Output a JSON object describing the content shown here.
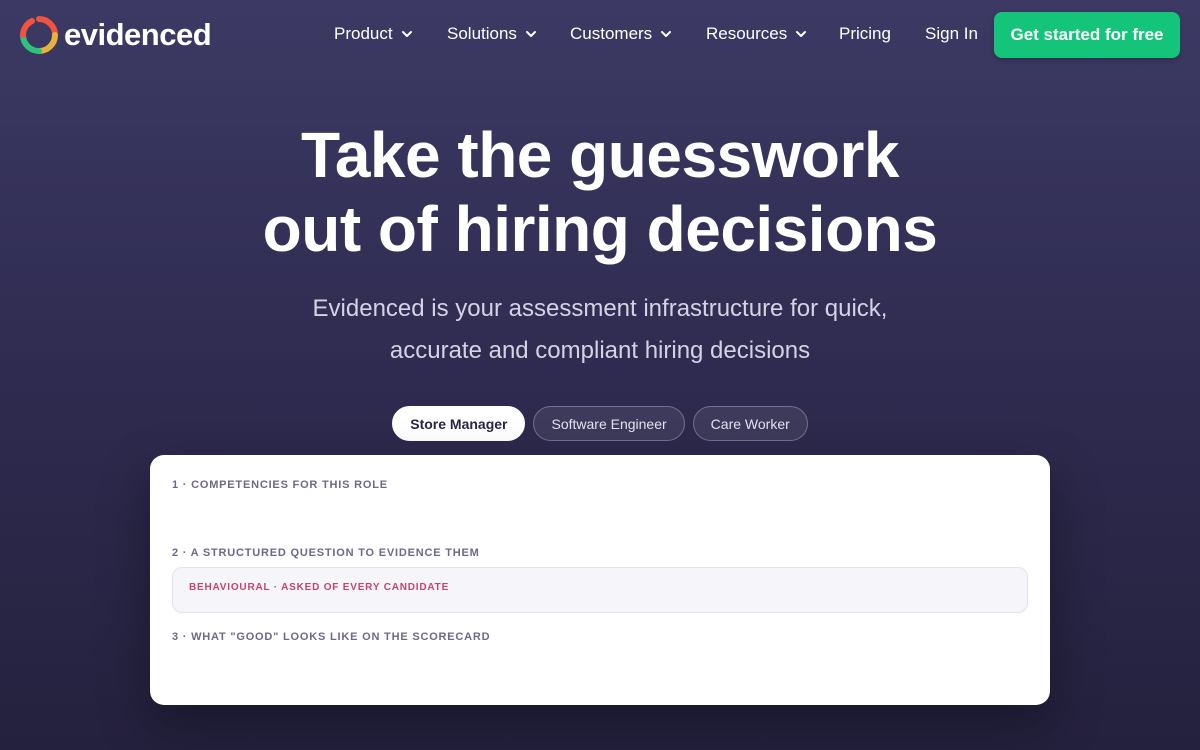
{
  "brand": {
    "name": "evidenced"
  },
  "nav": {
    "items": [
      {
        "label": "Product",
        "has_dropdown": true
      },
      {
        "label": "Solutions",
        "has_dropdown": true
      },
      {
        "label": "Customers",
        "has_dropdown": true
      },
      {
        "label": "Resources",
        "has_dropdown": true
      },
      {
        "label": "Pricing",
        "has_dropdown": false
      },
      {
        "label": "Sign In",
        "has_dropdown": false
      }
    ],
    "cta_label": "Get started for free"
  },
  "hero": {
    "title_line1": "Take the guesswork",
    "title_line2": "out of hiring decisions",
    "subtitle_line1": "Evidenced is your assessment infrastructure for quick,",
    "subtitle_line2": "accurate and compliant hiring decisions"
  },
  "role_tabs": [
    {
      "label": "Store Manager",
      "active": true
    },
    {
      "label": "Software Engineer",
      "active": false
    },
    {
      "label": "Care Worker",
      "active": false
    }
  ],
  "card": {
    "step1": "1 · COMPETENCIES FOR THIS ROLE",
    "step2": "2 · A STRUCTURED QUESTION TO EVIDENCE THEM",
    "question_tag": "BEHAVIOURAL · ASKED OF EVERY CANDIDATE",
    "step3": "3 · WHAT \"GOOD\" LOOKS LIKE ON THE SCORECARD"
  },
  "colors": {
    "cta": "#13c47a",
    "background": "#302c52",
    "question_tag": "#c4466a"
  },
  "icons": [
    "evidenced-logo-icon",
    "chevron-down-icon"
  ]
}
